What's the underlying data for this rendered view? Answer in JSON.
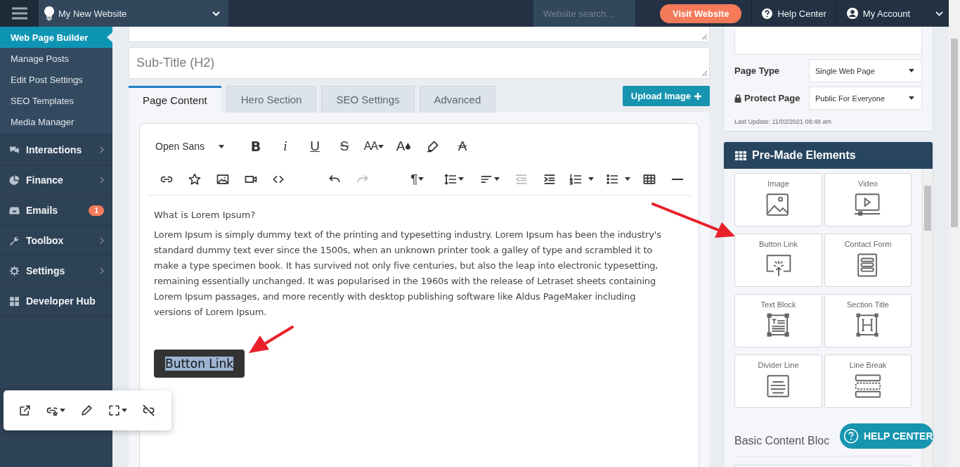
{
  "topbar": {
    "site": "My New Website",
    "search": {
      "placeholder": "Website search..."
    },
    "visit_button": "Visit Website",
    "help": "Help Center",
    "account": "My Account"
  },
  "sidebar": {
    "sub_items": [
      {
        "label": "Web Page Builder",
        "selected": true
      },
      {
        "label": "Manage Posts",
        "selected": false
      },
      {
        "label": "Edit Post Settings",
        "selected": false
      },
      {
        "label": "SEO Templates",
        "selected": false
      },
      {
        "label": "Media Manager",
        "selected": false
      }
    ],
    "items": [
      {
        "kind": "chat",
        "label": "Interactions",
        "arrow": true
      },
      {
        "kind": "pie",
        "label": "Finance",
        "arrow": true
      },
      {
        "kind": "inbox",
        "label": "Emails",
        "badge": "1",
        "arrow": false
      },
      {
        "kind": "wrench",
        "label": "Toolbox",
        "arrow": true
      },
      {
        "kind": "gear",
        "label": "Settings",
        "arrow": true
      },
      {
        "kind": "grid",
        "label": "Developer Hub",
        "arrow": false
      }
    ]
  },
  "fields": [
    {
      "placeholder": "Sub-Title (H2)"
    }
  ],
  "tabs": [
    {
      "label": "Page Content",
      "selected": true
    },
    {
      "label": "Hero Section",
      "selected": false
    },
    {
      "label": "SEO Settings",
      "selected": false
    },
    {
      "label": "Advanced",
      "selected": false
    }
  ],
  "upload_button": "Upload Image",
  "toolbar": [
    [
      {
        "kind": "font",
        "label": "Open Sans"
      },
      {
        "kind": "bold",
        "glyph": "B"
      },
      {
        "kind": "italic",
        "glyph": "i"
      },
      {
        "kind": "underline",
        "glyph": "U"
      },
      {
        "kind": "strike",
        "glyph": "S"
      },
      {
        "kind": "size",
        "glyph": "AA"
      },
      {
        "kind": "color",
        "glyph": "A"
      },
      {
        "kind": "highlight"
      },
      {
        "kind": "clear",
        "glyph": "A"
      }
    ],
    [
      {
        "kind": "link",
        "disabled": false
      },
      {
        "kind": "star",
        "disabled": false
      },
      {
        "kind": "image",
        "disabled": false
      },
      {
        "kind": "video",
        "disabled": false
      },
      {
        "kind": "code",
        "disabled": false
      },
      {
        "kind": "undo",
        "disabled": false
      },
      {
        "kind": "redo",
        "disabled": true
      },
      {
        "kind": "paragraph",
        "glyph": "¶",
        "disabled": false
      },
      {
        "kind": "line-height",
        "disabled": false
      },
      {
        "kind": "align",
        "disabled": false
      },
      {
        "kind": "outdent",
        "disabled": true
      },
      {
        "kind": "indent",
        "disabled": false
      },
      {
        "kind": "ordered-list",
        "disabled": false
      },
      {
        "kind": "bullet-list",
        "disabled": false
      },
      {
        "kind": "table",
        "disabled": false
      },
      {
        "kind": "rule",
        "disabled": false
      }
    ]
  ],
  "content": {
    "heading": "What is Lorem Ipsum?",
    "paragraph": "Lorem Ipsum is simply dummy text of the printing and typesetting industry. Lorem Ipsum has been the industry's standard dummy text ever since the 1500s, when an unknown printer took a galley of type and scrambled it to make a type specimen book. It has survived not only five centuries, but also the leap into electronic typesetting, remaining essentially unchanged. It was popularised in the 1960s with the release of Letraset sheets containing Lorem Ipsum passages, and more recently with desktop publishing software like Aldus PageMaker including versions of Lorem Ipsum.",
    "button_link": "Button Link"
  },
  "link_popup": [
    {
      "kind": "open"
    },
    {
      "kind": "style"
    },
    {
      "kind": "edit"
    },
    {
      "kind": "size"
    },
    {
      "kind": "unlink"
    }
  ],
  "page_settings": {
    "page_type_label": "Page Type",
    "page_type": "Single Web Page",
    "protect_label": "Protect Page",
    "protect": "Public For Everyone",
    "last_update": "Last Update: 11/02/2021 08:48 am"
  },
  "elements": {
    "title": "Pre-Made Elements",
    "items": [
      {
        "kind": "image",
        "label": "Image"
      },
      {
        "kind": "video",
        "label": "Video"
      },
      {
        "kind": "button",
        "label": "Button Link"
      },
      {
        "kind": "form",
        "label": "Contact Form"
      },
      {
        "kind": "text",
        "label": "Text Block"
      },
      {
        "kind": "title",
        "label": "Section Title"
      },
      {
        "kind": "divider",
        "label": "Divider Line"
      },
      {
        "kind": "break",
        "label": "Line Break"
      }
    ],
    "section": "Basic Content Bloc"
  },
  "help_button": "HELP CENTER"
}
